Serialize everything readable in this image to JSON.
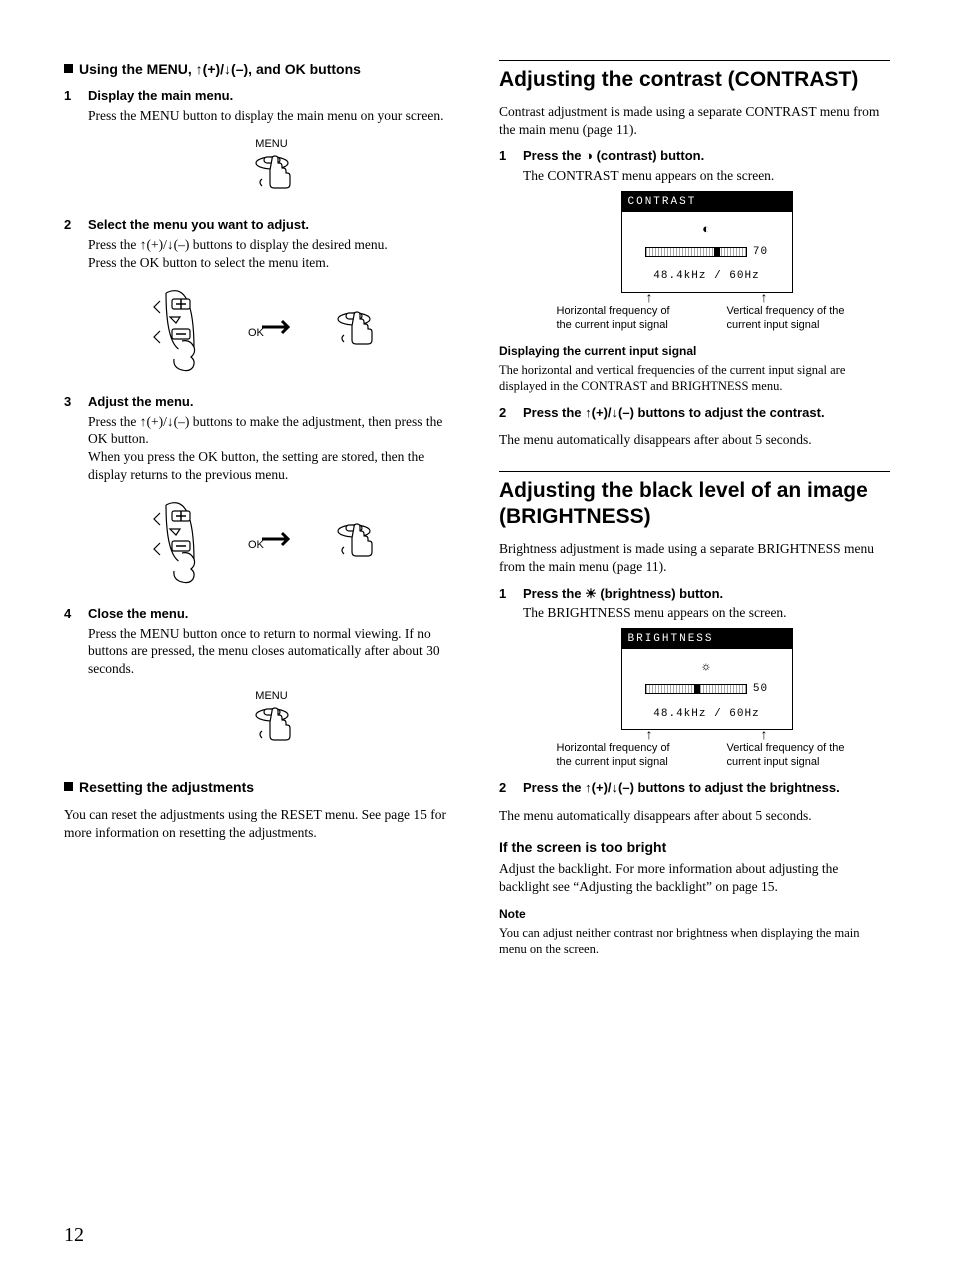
{
  "pageNumber": "12",
  "left": {
    "section1_title": "Using the MENU, ↑(+)/↓(–), and OK buttons",
    "steps": [
      {
        "title": "Display the main menu.",
        "body": "Press the MENU button to display the main menu on your screen.",
        "illus_label": "MENU"
      },
      {
        "title": "Select the menu you want to adjust.",
        "body1": "Press the ↑(+)/↓(–) buttons to display the desired menu.",
        "body2": "Press the OK button to select the menu item.",
        "ok_label": "OK"
      },
      {
        "title": "Adjust the menu.",
        "body1": "Press the ↑(+)/↓(–) buttons to make the adjustment, then press the OK button.",
        "body2": "When you press the OK button, the setting are stored, then the display returns to the previous menu.",
        "ok_label": "OK"
      },
      {
        "title": "Close the menu.",
        "body": "Press the MENU button once to return to normal viewing. If no buttons are pressed, the menu closes automatically after about 30 seconds.",
        "illus_label": "MENU"
      }
    ],
    "section2_title": "Resetting the adjustments",
    "section2_body": "You can reset the adjustments using the RESET menu. See page 15 for more information on resetting the adjustments."
  },
  "right": {
    "contrast": {
      "heading": "Adjusting the contrast (CONTRAST)",
      "intro": "Contrast adjustment is made using a separate CONTRAST menu from the main menu (page 11).",
      "step1_title": "Press the ◑ (contrast) button.",
      "step1_body": "The CONTRAST menu appears on the screen.",
      "osd_title": "CONTRAST",
      "osd_value": "70",
      "osd_freq": "48.4kHz / 60Hz",
      "callout_h": "Horizontal frequency of the current input signal",
      "callout_v": "Vertical frequency of the current input signal",
      "disp_title": "Displaying the current input signal",
      "disp_body": "The horizontal and vertical frequencies of the current input signal are displayed in the CONTRAST and BRIGHTNESS menu.",
      "step2_title": "Press the ↑(+)/↓(–) buttons to adjust the contrast.",
      "tail": "The menu automatically disappears after about 5 seconds."
    },
    "brightness": {
      "heading": "Adjusting the black level of an image (BRIGHTNESS)",
      "intro": "Brightness adjustment is made using a separate BRIGHTNESS menu from the main menu (page 11).",
      "step1_title": "Press the ☀ (brightness) button.",
      "step1_body": "The BRIGHTNESS menu appears on the screen.",
      "osd_title": "BRIGHTNESS",
      "osd_value": "50",
      "osd_freq": "48.4kHz / 60Hz",
      "callout_h": "Horizontal frequency of the current input signal",
      "callout_v": "Vertical frequency of the current input signal",
      "step2_title": "Press the ↑(+)/↓(–) buttons to adjust the brightness.",
      "tail": "The menu automatically disappears after about 5 seconds.",
      "bright_heading": "If the screen is too bright",
      "bright_body": "Adjust the backlight. For more information about adjusting the backlight see “Adjusting the backlight” on page 15.",
      "note_label": "Note",
      "note_body": "You can adjust neither contrast nor brightness when displaying the main menu on the screen."
    }
  }
}
